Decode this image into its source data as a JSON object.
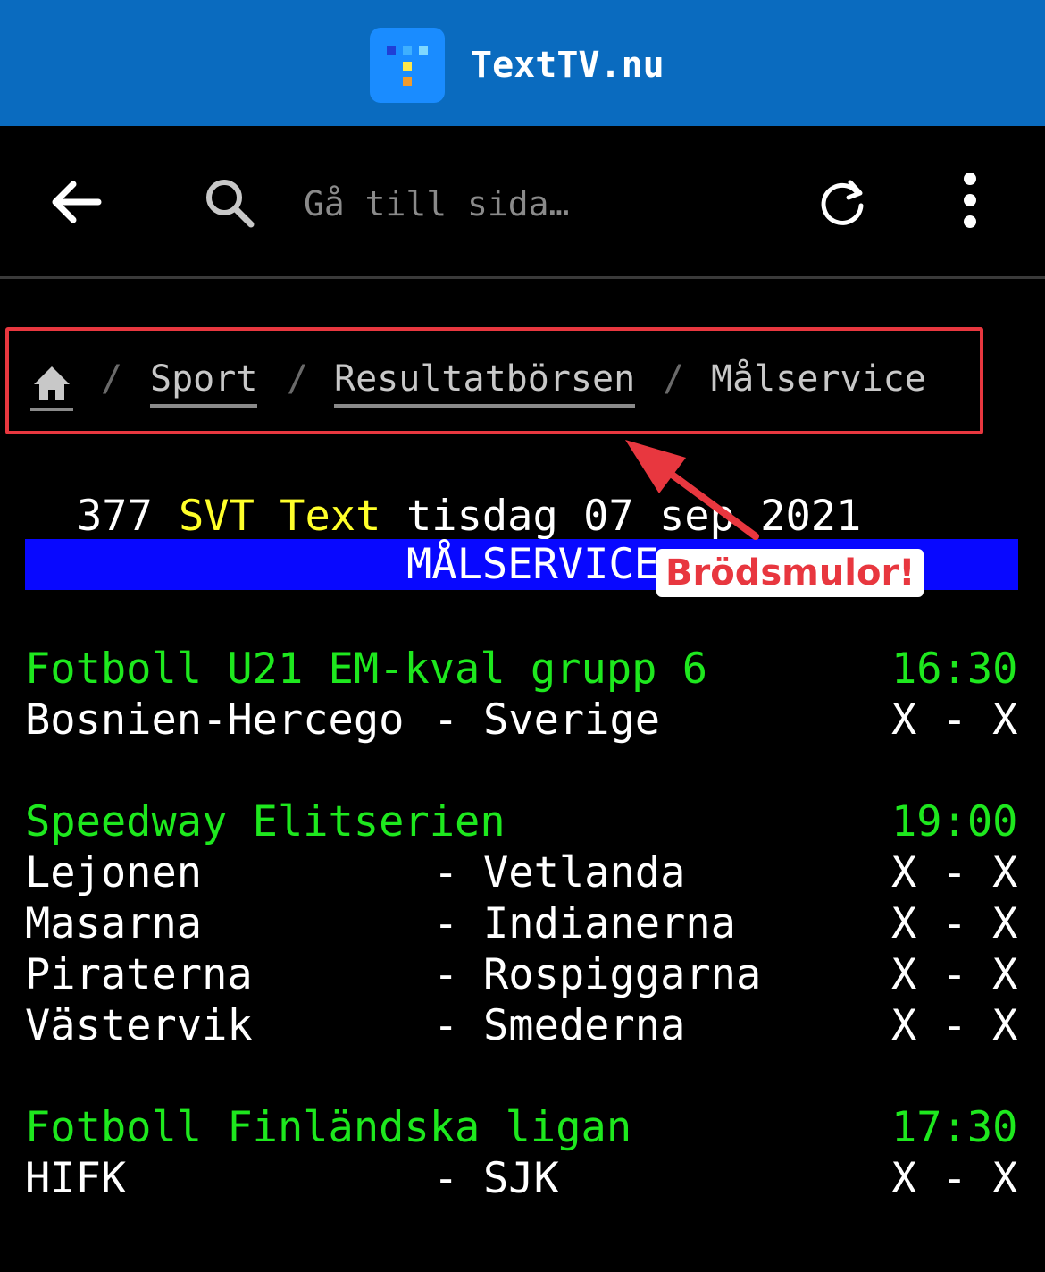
{
  "appbar": {
    "title": "TextTV.nu",
    "logo_icon": "texttv-logo-icon",
    "color": "#0a6bbf"
  },
  "toolbar": {
    "back_icon": "back-arrow-icon",
    "search_icon": "search-icon",
    "search_placeholder": "Gå till sida…",
    "refresh_icon": "refresh-icon",
    "menu_icon": "more-vert-icon"
  },
  "breadcrumbs": {
    "home_icon": "home-icon",
    "items": [
      "Sport",
      "Resultatbörsen",
      "Målservice"
    ],
    "separator": "/"
  },
  "annotation": {
    "label": "Brödsmulor!",
    "color": "#e8373f"
  },
  "page": {
    "header": {
      "number": "377",
      "brand": "SVT Text",
      "date": "tisdag 07 sep 2021"
    },
    "banner": "MÅLSERVICE",
    "sections": [
      {
        "title": "Fotboll U21 EM-kval grupp 6",
        "time": "16:30",
        "matches": [
          {
            "home": "Bosnien-Hercego",
            "away": "Sverige",
            "score": "X - X"
          }
        ]
      },
      {
        "title": "Speedway Elitserien",
        "time": "19:00",
        "matches": [
          {
            "home": "Lejonen",
            "away": "Vetlanda",
            "score": "X - X"
          },
          {
            "home": "Masarna",
            "away": "Indianerna",
            "score": "X - X"
          },
          {
            "home": "Piraterna",
            "away": "Rospiggarna",
            "score": "X - X"
          },
          {
            "home": "Västervik",
            "away": "Smederna",
            "score": "X - X"
          }
        ]
      },
      {
        "title": "Fotboll Finländska ligan",
        "time": "17:30",
        "matches": [
          {
            "home": "HIFK",
            "away": "SJK",
            "score": "X - X"
          }
        ]
      }
    ],
    "dash": "-"
  }
}
